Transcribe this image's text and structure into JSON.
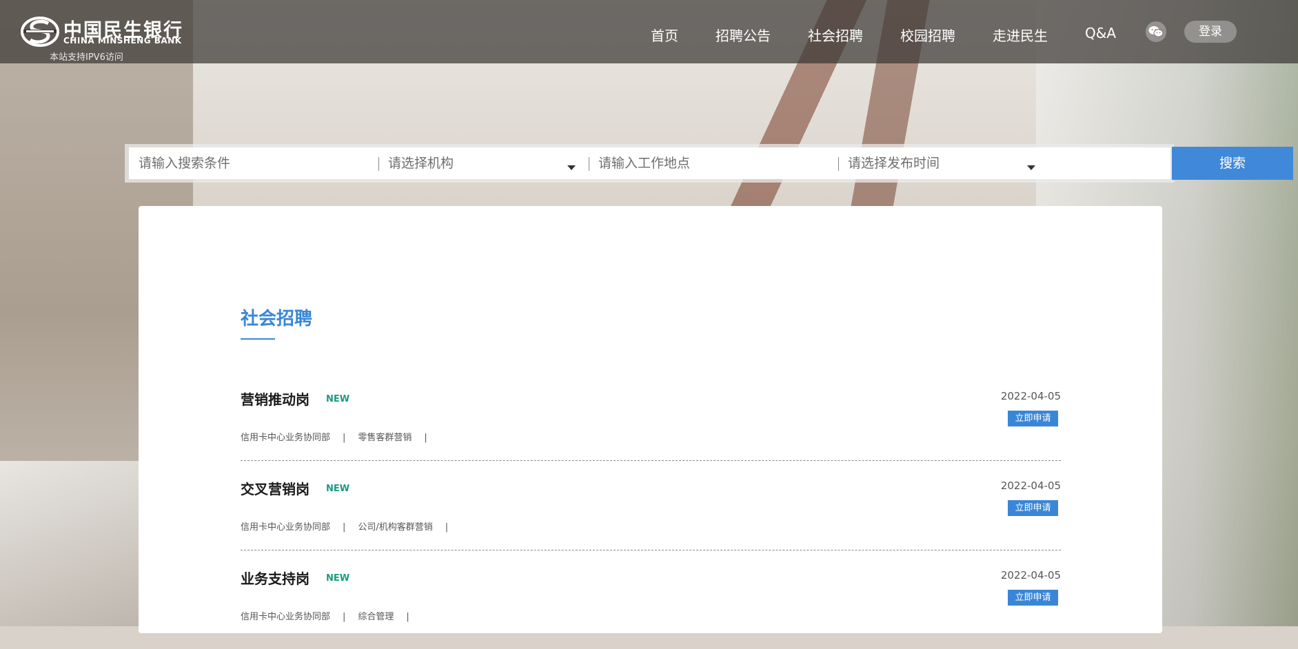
{
  "brand": {
    "name_cn": "中国民生银行",
    "name_en": "CHINA MINSHENG BANK",
    "ipv6_notice": "本站支持IPV6访问"
  },
  "nav": {
    "items": [
      "首页",
      "招聘公告",
      "社会招聘",
      "校园招聘",
      "走进民生",
      "Q&A"
    ],
    "wechat_icon": "wechat-icon",
    "login_label": "登录"
  },
  "search": {
    "keyword_placeholder": "请输入搜索条件",
    "org_placeholder": "请选择机构",
    "location_placeholder": "请输入工作地点",
    "time_placeholder": "请选择发布时间",
    "button_label": "搜索"
  },
  "section": {
    "title": "社会招聘"
  },
  "jobs": [
    {
      "title": "营销推动岗",
      "badge": "NEW",
      "date": "2022-04-05",
      "apply_label": "立即申请",
      "department": "信用卡中心业务协同部",
      "category": "零售客群营销",
      "sep": "|"
    },
    {
      "title": "交叉营销岗",
      "badge": "NEW",
      "date": "2022-04-05",
      "apply_label": "立即申请",
      "department": "信用卡中心业务协同部",
      "category": "公司/机构客群营销",
      "sep": "|"
    },
    {
      "title": "业务支持岗",
      "badge": "NEW",
      "date": "2022-04-05",
      "apply_label": "立即申请",
      "department": "信用卡中心业务协同部",
      "category": "综合管理",
      "sep": "|"
    }
  ],
  "colors": {
    "accent": "#3a86d6",
    "search_button": "#4089d8",
    "new_badge": "#1a9a80"
  }
}
